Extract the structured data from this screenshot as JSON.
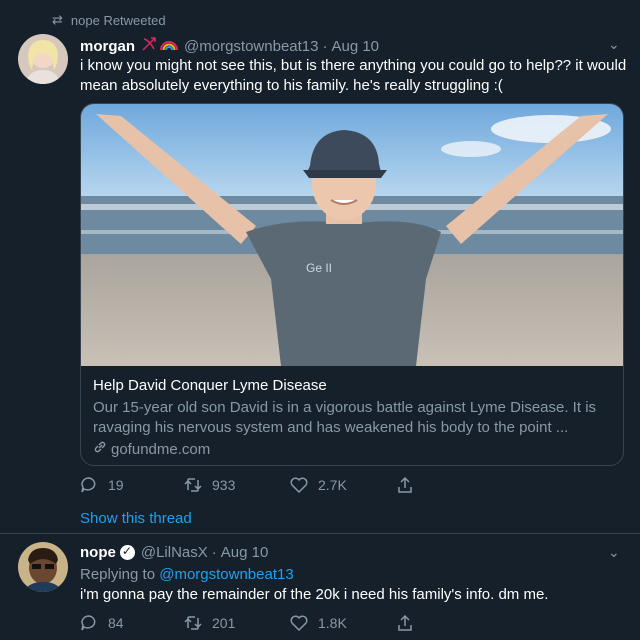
{
  "retweet_label": "nope Retweeted",
  "tweet1": {
    "name": "morgan",
    "handle": "@morgstownbeat13",
    "date": "Aug 10",
    "text": "i know you might not see this, but is there anything you could go to help?? it would mean absolutely everything to his family. he's really struggling :(",
    "card": {
      "title": "Help David Conquer Lyme Disease",
      "description": "Our 15-year old son David is in a vigorous battle against Lyme Disease. It is ravaging his nervous system and has weakened his body to the point ...",
      "domain": "gofundme.com"
    },
    "replies": "19",
    "retweets": "933",
    "likes": "2.7K"
  },
  "show_thread": "Show this thread",
  "tweet2": {
    "name": "nope",
    "handle": "@LilNasX",
    "date": "Aug 10",
    "replying_prefix": "Replying to",
    "replying_to": "@morgstownbeat13",
    "text": "i'm gonna pay the remainder of the 20k i need his family's info. dm me.",
    "replies": "84",
    "retweets": "201",
    "likes": "1.8K"
  },
  "colors": {
    "background": "#15202b",
    "muted": "#8899a6",
    "link": "#1da1f2"
  }
}
